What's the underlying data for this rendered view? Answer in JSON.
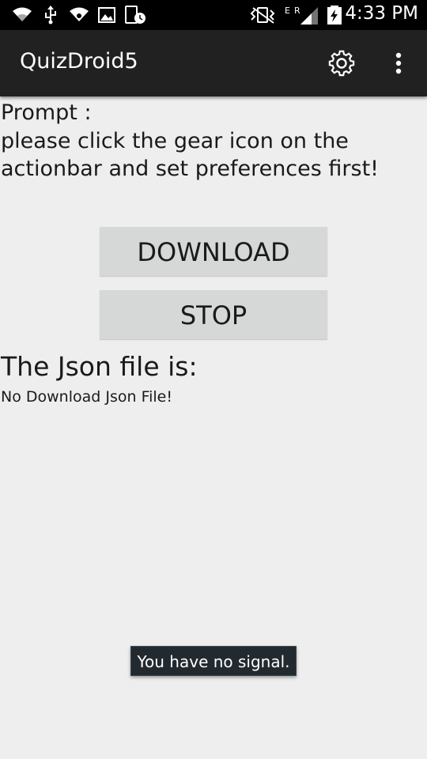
{
  "status_bar": {
    "time": "4:33 PM",
    "icons": [
      "wifi-icon",
      "usb-icon",
      "wifi-hotspot-icon",
      "gallery-icon",
      "screenshot-icon",
      "vibrate-icon",
      "signal-E-icon",
      "signal-R-icon",
      "battery-charging-icon"
    ]
  },
  "action_bar": {
    "title": "QuizDroid5",
    "settings_icon": "gear-icon",
    "overflow_icon": "overflow-menu-icon"
  },
  "main": {
    "prompt_label": "Prompt :",
    "prompt_text": "please click the gear icon on the actionbar and set preferences first!",
    "download_label": "DOWNLOAD",
    "stop_label": "STOP",
    "json_heading": "The Json file is:",
    "json_status": "No Download Json File!"
  },
  "toast": {
    "message": "You have no signal."
  },
  "colors": {
    "background": "#eeeeee",
    "action_bar": "#212121",
    "status_bar": "#000000",
    "button": "#d6d7d7",
    "toast": "#222a30"
  }
}
